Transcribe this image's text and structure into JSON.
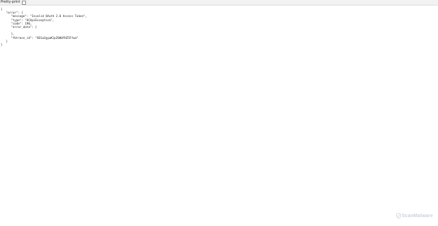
{
  "toolbar": {
    "pretty_print_label": "Pretty-print",
    "pretty_print_checked": false
  },
  "json_lines": [
    "{",
    "   \"error\": {",
    "      \"message\": \"Invalid OAuth 2.0 Access Token\",",
    "      \"type\": \"OCApiException\",",
    "      \"code\": 190,",
    "      \"error_data\": {",
    "",
    "      },",
    "      \"fbtrace_id\": \"AD1a3gywK1pZ0H0fHZ5Ffwa\"",
    "   }",
    "}"
  ],
  "watermark": {
    "text": "ScanMalware",
    "icon": "shield-icon"
  }
}
